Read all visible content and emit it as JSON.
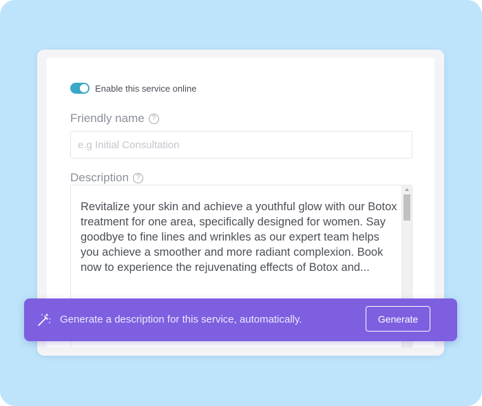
{
  "toggle": {
    "label": "Enable this service online",
    "enabled": true,
    "color": "#3aa8c6"
  },
  "friendly_name": {
    "label": "Friendly name",
    "help_icon": "question-circle-icon",
    "placeholder": "e.g Initial Consultation",
    "value": ""
  },
  "description": {
    "label": "Description",
    "help_icon": "question-circle-icon",
    "text": "Revitalize your skin and achieve a youthful glow with our Botox treatment for one area, specifically designed for women. Say goodbye to fine lines and wrinkles as our expert team helps you achieve a smoother and more radiant complexion. Book now to experience the rejuvenating effects of Botox and..."
  },
  "ai_banner": {
    "icon": "magic-wand-icon",
    "text": "Generate a description for this service, automatically.",
    "button_label": "Generate",
    "color": "#7d5fe0"
  },
  "colors": {
    "background": "#bde4fb",
    "card": "#f4f4f6"
  }
}
